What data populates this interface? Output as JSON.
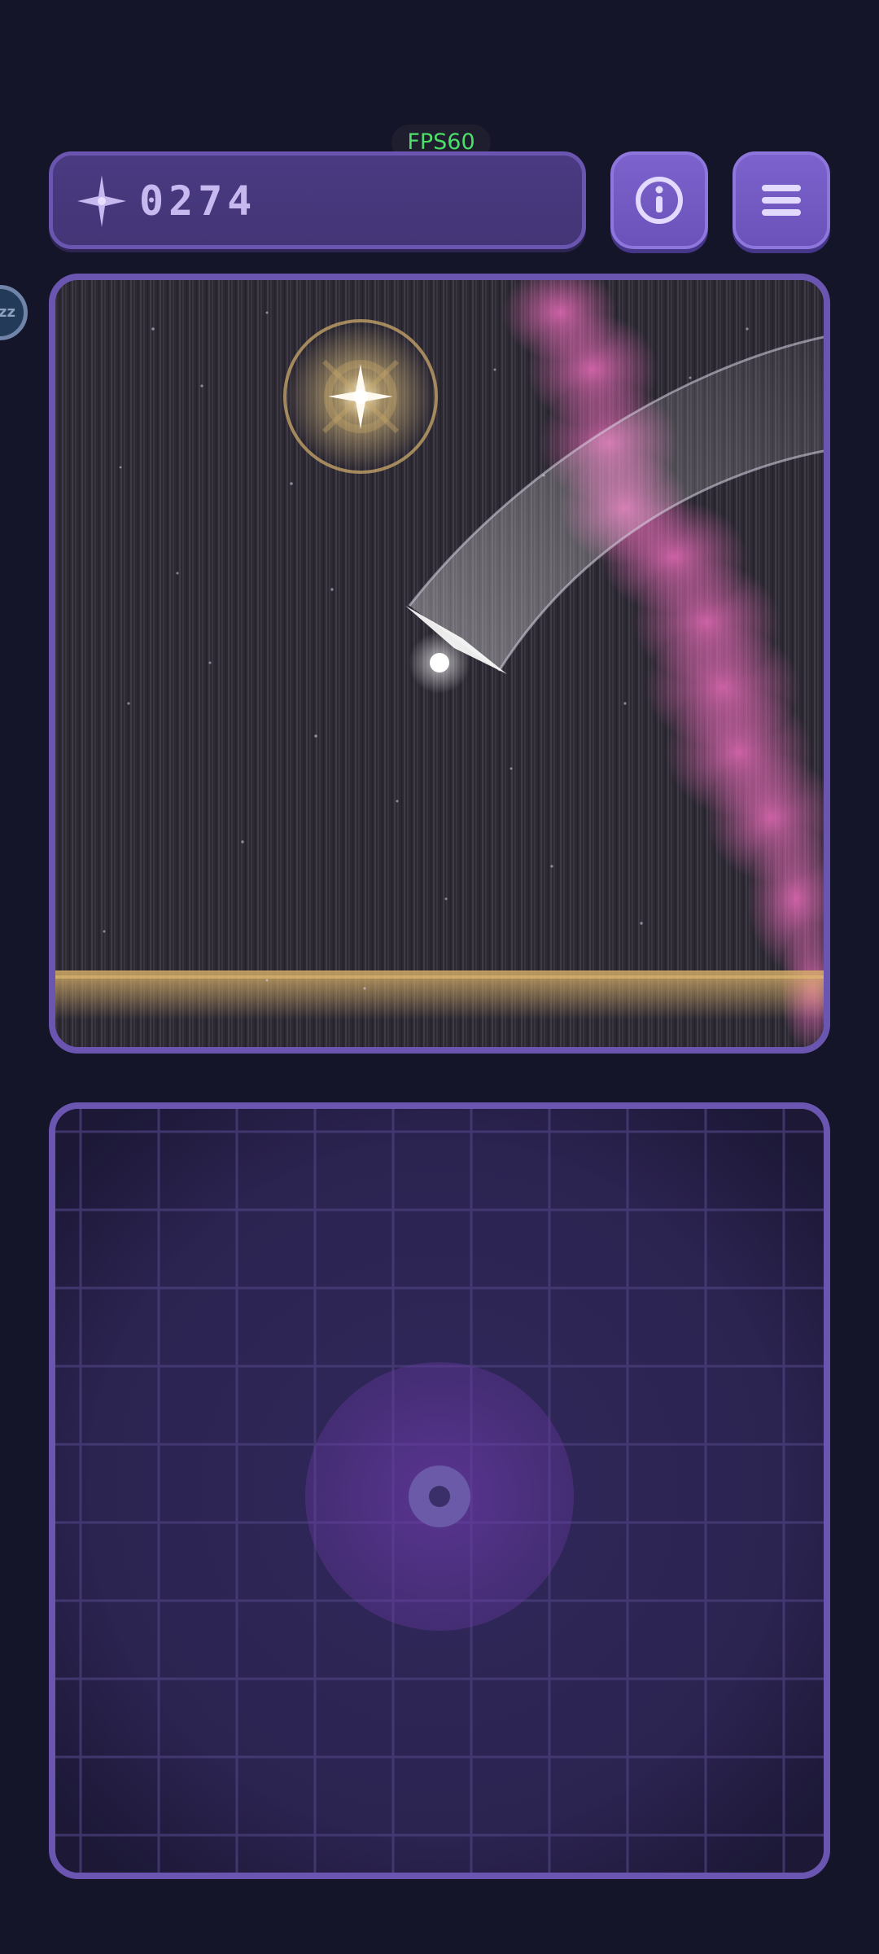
{
  "hud": {
    "fps_label": "FPS60",
    "score": "0274",
    "score_icon": "sparkle-icon",
    "info_icon": "info-icon",
    "menu_icon": "hamburger-menu-icon",
    "sleep_badge": "zz"
  },
  "colors": {
    "background": "#15152a",
    "panel": "#4a3a82",
    "panel_border": "#6a56b0",
    "button": "#7c62cc",
    "fps_text": "#4ede6a",
    "score_text": "#c7b8f0",
    "pink_cloud": "#e86bb8",
    "ground_glow": "#d8b068",
    "target_glow": "#ffe7a8"
  }
}
